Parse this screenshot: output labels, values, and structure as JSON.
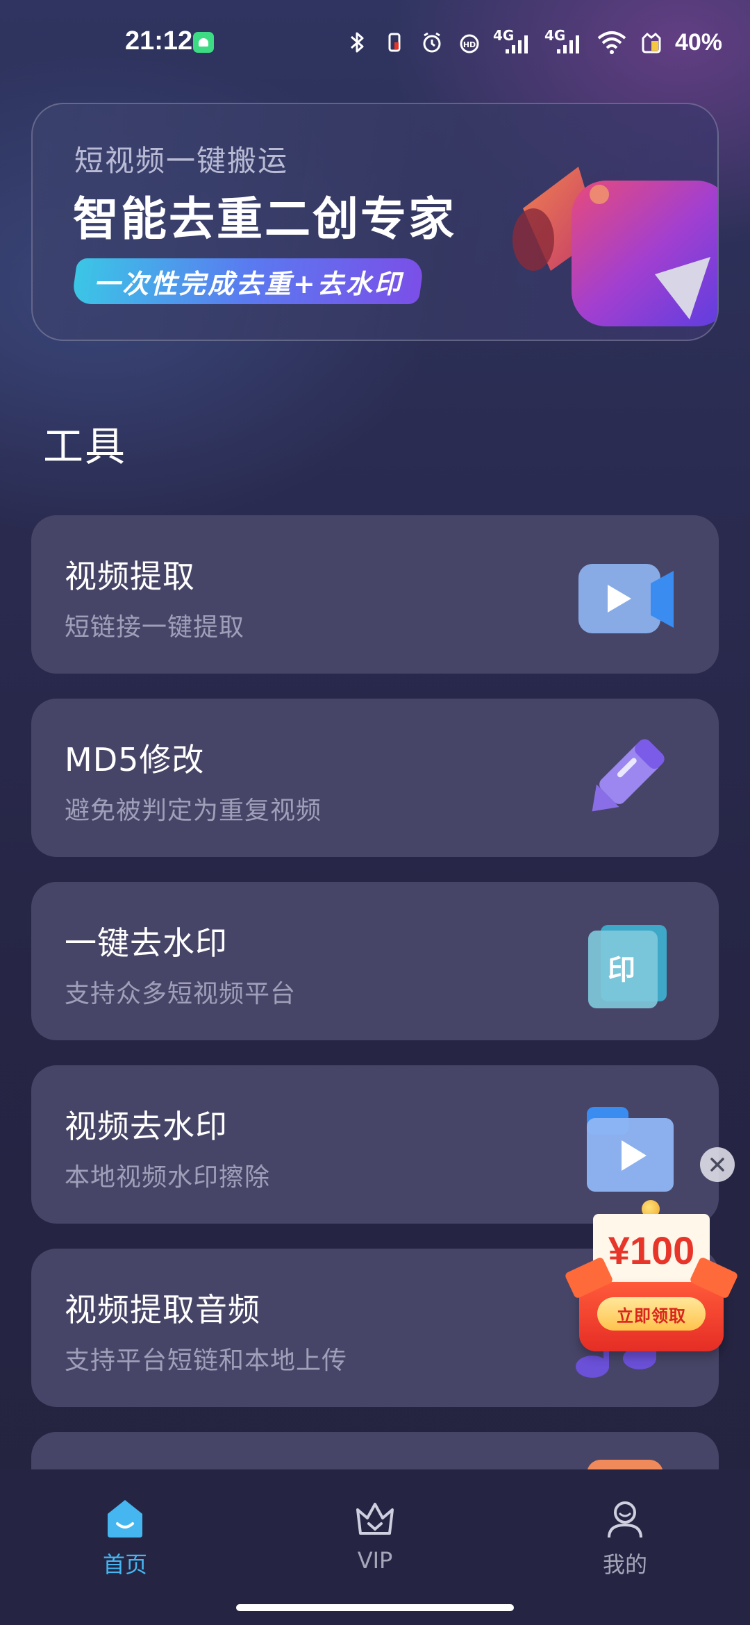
{
  "status_bar": {
    "time": "21:12",
    "network_1": "4G",
    "network_2": "4G",
    "battery": "40%"
  },
  "banner": {
    "subtitle": "短视频一键搬运",
    "title": "智能去重二创专家",
    "pill": "一次性完成去重+去水印"
  },
  "tools_section": {
    "title": "工具",
    "items": [
      {
        "title": "视频提取",
        "desc": "短链接一键提取",
        "icon": "video-camera-icon"
      },
      {
        "title": "MD5修改",
        "desc": "避免被判定为重复视频",
        "icon": "pen-icon"
      },
      {
        "title": "一键去水印",
        "desc": "支持众多短视频平台",
        "icon": "stamp-icon"
      },
      {
        "title": "视频去水印",
        "desc": "本地视频水印擦除",
        "icon": "video-folder-icon"
      },
      {
        "title": "视频提取音频",
        "desc": "支持平台短链和本地上传",
        "icon": "music-note-icon"
      }
    ]
  },
  "promo": {
    "amount": "¥100",
    "button": "立即领取"
  },
  "bottom_nav": {
    "items": [
      {
        "label": "首页",
        "active": true
      },
      {
        "label": "VIP",
        "active": false
      },
      {
        "label": "我的",
        "active": false
      }
    ]
  },
  "colors": {
    "accent": "#46b6f0",
    "card_bg": "#474567",
    "page_bg": "#272746"
  }
}
